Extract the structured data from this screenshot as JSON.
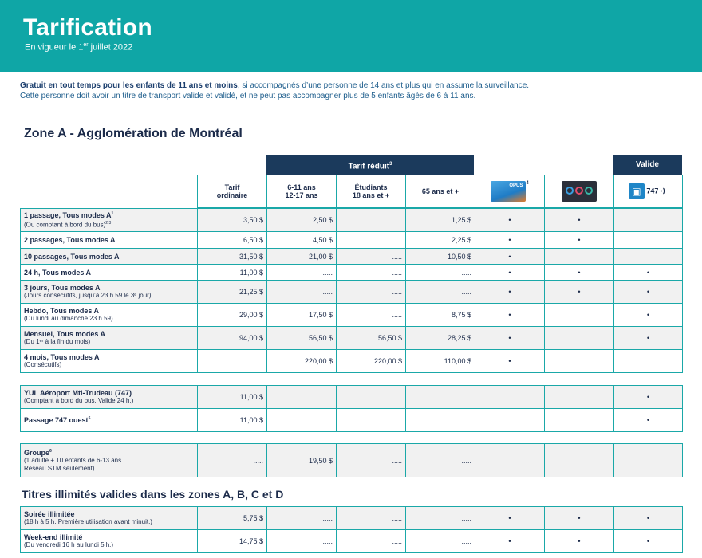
{
  "header": {
    "title": "Tarification",
    "subtitle_pre": "En vigueur le 1",
    "subtitle_sup": "er",
    "subtitle_post": " juillet 2022"
  },
  "intro": {
    "bold": "Gratuit en tout temps pour les enfants de 11 ans et moins",
    "line1_rest": ", si accompagnés d’une personne de 14 ans et plus qui en assume la surveillance.",
    "line2": "Cette personne doit avoir un titre de transport valide et validé, et ne peut pas accompagner plus de 5 enfants âgés de 6 à 11 ans."
  },
  "section_a": {
    "title": "Zone A - Agglomération de Montréal"
  },
  "section_b": {
    "title": "Titres illimités valides dans les zones A, B, C et D"
  },
  "bands": {
    "tarif_reduit": "Tarif réduit",
    "tarif_reduit_sup": "3",
    "valide": "Valide"
  },
  "columns": {
    "ordinaire_1": "Tarif",
    "ordinaire_2": "ordinaire",
    "child_1": "6-11 ans",
    "child_2": "12-17 ans",
    "student_1": "Étudiants",
    "student_2": "18 ans et +",
    "senior": "65 ans et +",
    "opus_text": "OPUS",
    "opus_sup": "4",
    "bus_747": "747"
  },
  "icons": {
    "opus": "opus-card-icon",
    "occasional": "occasional-card-icon",
    "bus": "bus-icon",
    "plane": "plane-icon"
  },
  "colors": {
    "header": "#0fa6a6",
    "band": "#1b3a5c",
    "border": "#1aa8a8"
  },
  "rows_a": [
    {
      "name": "1 passage, Tous modes A",
      "name_sup": "1",
      "sub": "(Ou comptant à bord du bus)",
      "sub_sup": "2,3",
      "ord": "3,50 $",
      "child": "2,50 $",
      "student": ".....",
      "senior": "1,25 $",
      "opus": "•",
      "occ": "•",
      "val": ""
    },
    {
      "name": "2 passages, Tous modes A",
      "name_sup": "",
      "sub": "",
      "sub_sup": "",
      "ord": "6,50 $",
      "child": "4,50 $",
      "student": ".....",
      "senior": "2,25 $",
      "opus": "•",
      "occ": "•",
      "val": ""
    },
    {
      "name": "10 passages, Tous modes A",
      "name_sup": "",
      "sub": "",
      "sub_sup": "",
      "ord": "31,50 $",
      "child": "21,00 $",
      "student": ".....",
      "senior": "10,50 $",
      "opus": "•",
      "occ": "",
      "val": ""
    },
    {
      "name": "24 h, Tous modes A",
      "name_sup": "",
      "sub": "",
      "sub_sup": "",
      "ord": "11,00 $",
      "child": ".....",
      "student": ".....",
      "senior": ".....",
      "opus": "•",
      "occ": "•",
      "val": "•"
    },
    {
      "name": "3 jours, Tous modes A",
      "name_sup": "",
      "sub": "(Jours consécutifs, jusqu’à 23 h 59 le 3ᵉ jour)",
      "sub_sup": "",
      "ord": "21,25 $",
      "child": ".....",
      "student": ".....",
      "senior": ".....",
      "opus": "•",
      "occ": "•",
      "val": "•"
    },
    {
      "name": "Hebdo, Tous modes A",
      "name_sup": "",
      "sub": "(Du lundi au dimanche 23 h 59)",
      "sub_sup": "",
      "ord": "29,00 $",
      "child": "17,50 $",
      "student": ".....",
      "senior": "8,75 $",
      "opus": "•",
      "occ": "",
      "val": "•"
    },
    {
      "name": "Mensuel, Tous modes A",
      "name_sup": "",
      "sub": "(Du 1ᵉʳ à la fin du mois)",
      "sub_sup": "",
      "ord": "94,00 $",
      "child": "56,50 $",
      "student": "56,50 $",
      "senior": "28,25 $",
      "opus": "•",
      "occ": "",
      "val": "•"
    },
    {
      "name": "4 mois, Tous modes A",
      "name_sup": "",
      "sub": "(Consécutifs)",
      "sub_sup": "",
      "ord": ".....",
      "child": "220,00 $",
      "student": "220,00 $",
      "senior": "110,00 $",
      "opus": "•",
      "occ": "",
      "val": ""
    }
  ],
  "rows_yul": [
    {
      "name": "YUL Aéroport Mtl-Trudeau (747)",
      "name_sup": "",
      "sub": "(Comptant à bord du bus. Valide 24 h.)",
      "sub_sup": "",
      "ord": "11,00 $",
      "child": ".....",
      "student": ".....",
      "senior": ".....",
      "opus": "",
      "occ": "",
      "val": "•"
    },
    {
      "name": "Passage 747 ouest",
      "name_sup": "5",
      "sub": "",
      "sub_sup": "",
      "ord": "11,00 $",
      "child": ".....",
      "student": ".....",
      "senior": ".....",
      "opus": "",
      "occ": "",
      "val": "•"
    }
  ],
  "rows_group": [
    {
      "name": "Groupe",
      "name_sup": "6",
      "sub": "(1 adulte + 10 enfants de 6-13 ans.",
      "sub2": "Réseau STM seulement)",
      "ord": ".....",
      "child": "19,50 $",
      "student": ".....",
      "senior": ".....",
      "opus": "",
      "occ": "",
      "val": ""
    }
  ],
  "rows_b": [
    {
      "name": "Soirée illimitée",
      "name_sup": "",
      "sub": "(18 h à 5 h. Première utilisation avant minuit.)",
      "sub_sup": "",
      "ord": "5,75 $",
      "child": ".....",
      "student": ".....",
      "senior": ".....",
      "opus": "•",
      "occ": "•",
      "val": "•"
    },
    {
      "name": "Week-end illimité",
      "name_sup": "",
      "sub": "(Du vendredi 16 h au lundi 5 h.)",
      "sub_sup": "",
      "ord": "14,75 $",
      "child": ".....",
      "student": ".....",
      "senior": ".....",
      "opus": "•",
      "occ": "•",
      "val": "•"
    }
  ]
}
